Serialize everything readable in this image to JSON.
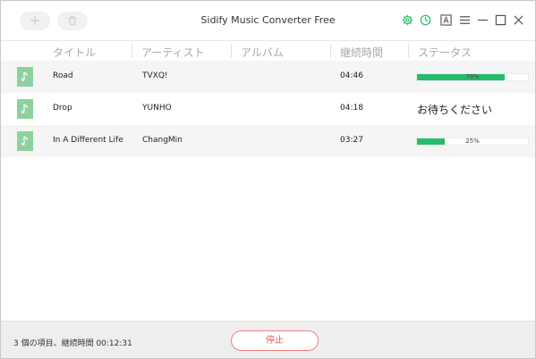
{
  "window": {
    "title": "Sidify Music Converter Free"
  },
  "toolbar": {
    "add_icon": "plus-icon",
    "delete_icon": "trash-icon",
    "settings_icon": "gear-icon",
    "history_icon": "clock-icon",
    "registration_icon": "a-box-icon",
    "menu_icon": "hamburger-icon",
    "accent_color": "#25bd6b"
  },
  "columns": [
    "タイトル",
    "アーティスト",
    "アルバム",
    "継続時間",
    "ステータス"
  ],
  "tracks": [
    {
      "title": "Road",
      "artist": "TVXQ!",
      "album": "",
      "duration": "04:46",
      "status_type": "progress",
      "progress": 0.79,
      "progress_label": "79%"
    },
    {
      "title": "Drop",
      "artist": "YUNHO",
      "album": "",
      "duration": "04:18",
      "status_type": "waiting",
      "status_text": "お待ちください"
    },
    {
      "title": "In A Different Life",
      "artist": "ChangMin",
      "album": "",
      "duration": "03:27",
      "status_type": "progress",
      "progress": 0.25,
      "progress_label": "25%"
    }
  ],
  "footer": {
    "info": "3 個の項目、継続時間 00:12:31",
    "stop_label": "停止"
  }
}
